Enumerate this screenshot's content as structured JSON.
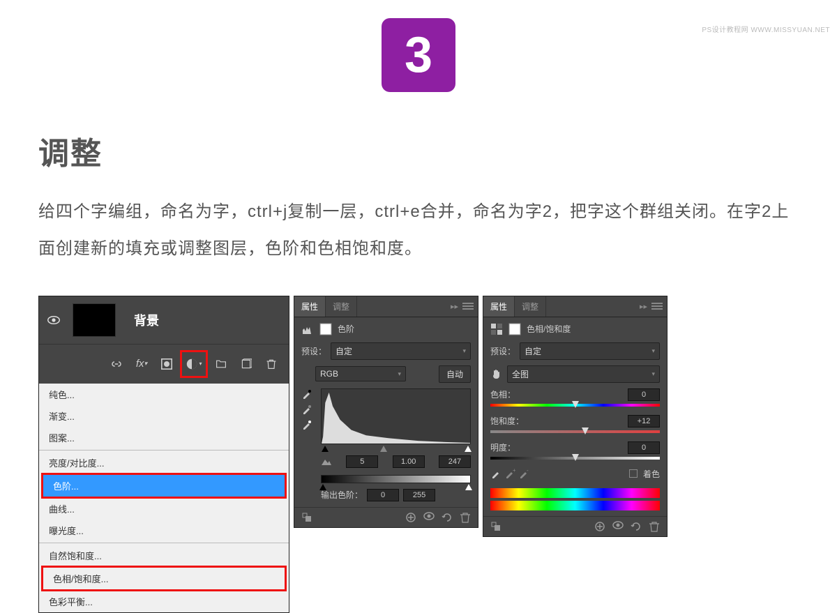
{
  "watermark": "PS设计教程网    WWW.MISSYUAN.NET",
  "step_number": "3",
  "heading": "调整",
  "description": "给四个字编组，命名为字，ctrl+j复制一层，ctrl+e合并，命名为字2，把字这个群组关闭。在字2上面创建新的填充或调整图层，色阶和色相饱和度。",
  "panel1": {
    "layer_name": "背景",
    "fx_label": "fx",
    "menu": {
      "solid_color": "纯色...",
      "gradient": "渐变...",
      "pattern": "图案...",
      "brightness": "亮度/对比度...",
      "levels": "色阶...",
      "curves": "曲线...",
      "exposure": "曝光度...",
      "vibrance": "自然饱和度...",
      "huesat": "色相/饱和度...",
      "colorbal": "色彩平衡..."
    }
  },
  "panel2": {
    "tab_properties": "属性",
    "tab_adjustments": "调整",
    "title": "色阶",
    "preset_label": "预设：",
    "preset_value": "自定",
    "channel": "RGB",
    "auto_button": "自动",
    "input_black": "5",
    "input_mid": "1.00",
    "input_white": "247",
    "output_label": "输出色阶：",
    "output_black": "0",
    "output_white": "255"
  },
  "panel3": {
    "tab_properties": "属性",
    "tab_adjustments": "调整",
    "title": "色相/饱和度",
    "preset_label": "预设：",
    "preset_value": "自定",
    "range_value": "全图",
    "hue_label": "色相：",
    "hue_value": "0",
    "sat_label": "饱和度：",
    "sat_value": "+12",
    "light_label": "明度：",
    "light_value": "0",
    "colorize_label": "着色"
  }
}
